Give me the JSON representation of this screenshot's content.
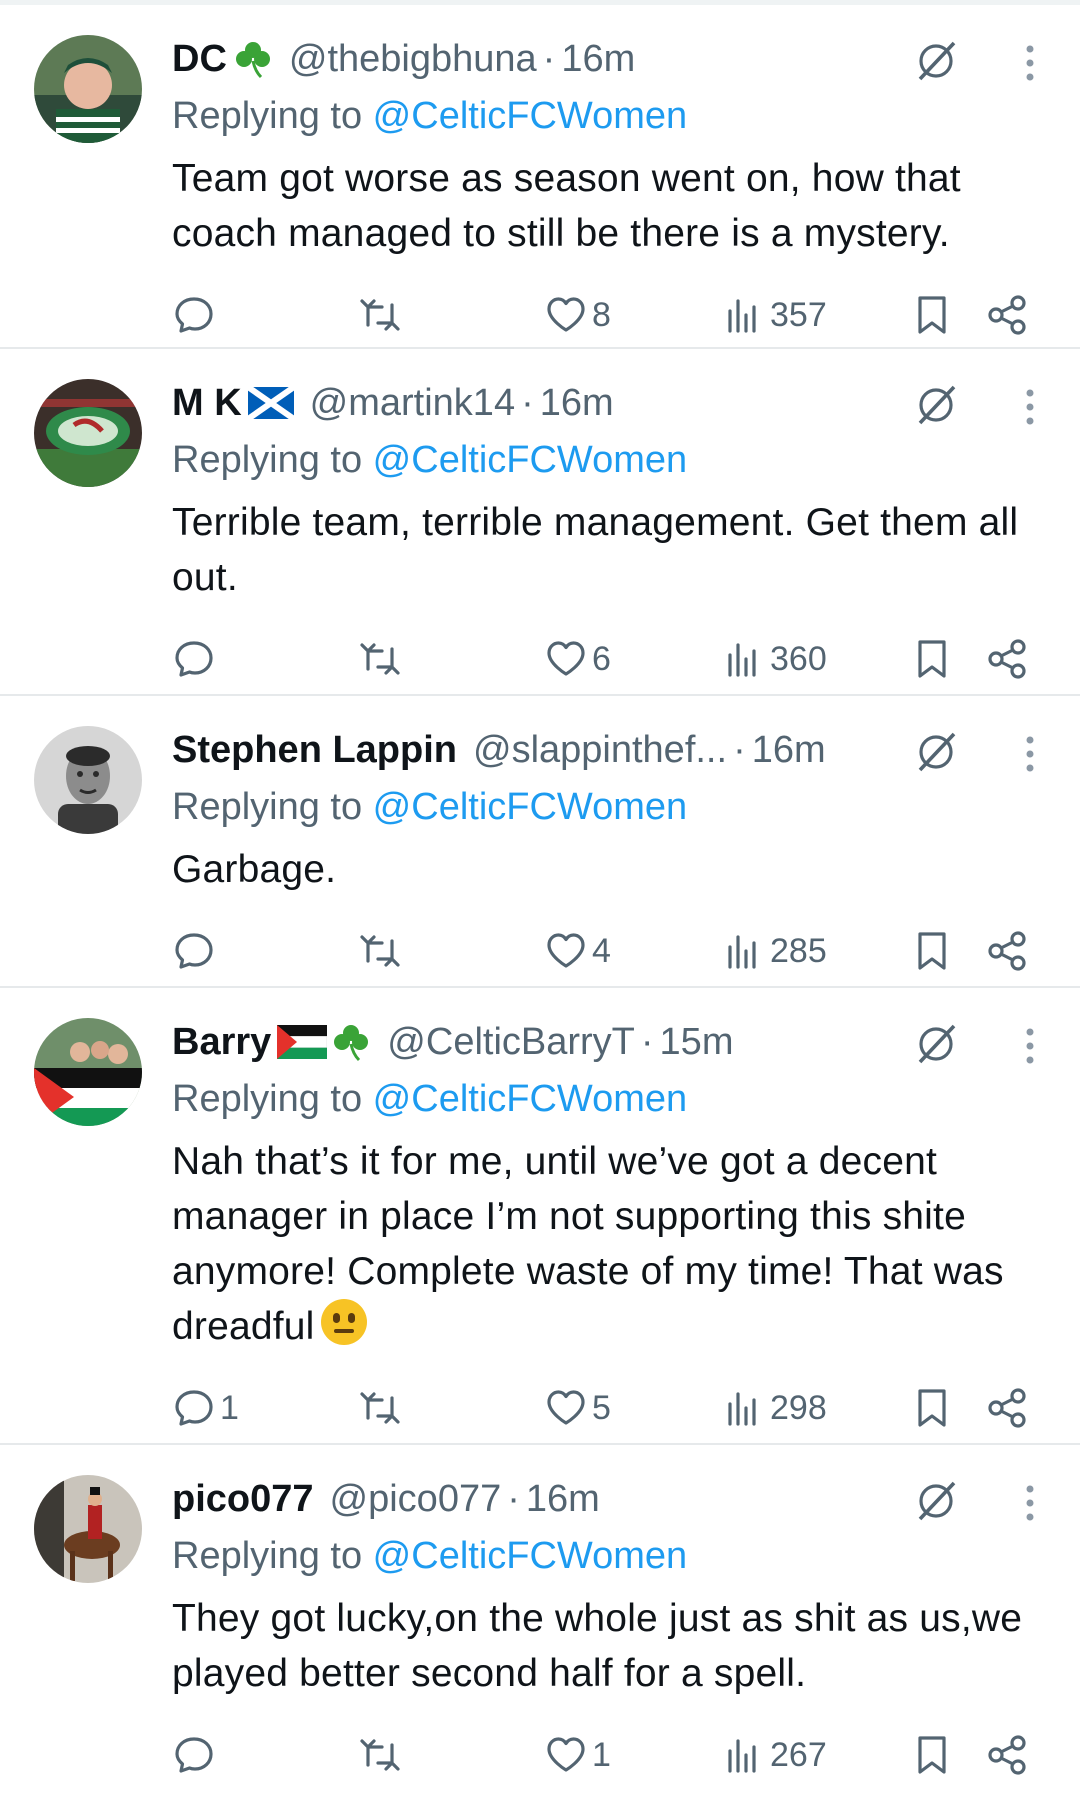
{
  "tweets": [
    {
      "name": "DC",
      "handle": "@thebigbhuna",
      "sep": "·",
      "time": "16m",
      "replying_prefix": "Replying to ",
      "replying_to": "@CelticFCWomen",
      "text": "Team got worse as season went on, how that coach managed to still be there is a mystery.",
      "replies": "",
      "likes": "8",
      "views": "357",
      "badges": [
        "shamrock-icon"
      ]
    },
    {
      "name": "M K",
      "handle": "@martink14",
      "sep": "·",
      "time": "16m",
      "replying_prefix": "Replying to ",
      "replying_to": "@CelticFCWomen",
      "text": "Terrible team, terrible management. Get them all out.",
      "replies": "",
      "likes": "6",
      "views": "360",
      "badges": [
        "scotland-flag-icon"
      ]
    },
    {
      "name": "Stephen Lappin",
      "handle": "@slappinthef...",
      "sep": "·",
      "time": "16m",
      "replying_prefix": "Replying to ",
      "replying_to": "@CelticFCWomen",
      "text": "Garbage.",
      "replies": "",
      "likes": "4",
      "views": "285",
      "badges": []
    },
    {
      "name": "Barry",
      "handle": "@CelticBarryT",
      "sep": "·",
      "time": "15m",
      "replying_prefix": "Replying to ",
      "replying_to": "@CelticFCWomen",
      "text": "Nah that’s it for me, until we’ve got a decent manager in place I’m not supporting this shite anymore! Complete waste of my time! That was dreadful",
      "replies": "1",
      "likes": "5",
      "views": "298",
      "badges": [
        "palestine-flag-icon",
        "shamrock-icon"
      ]
    },
    {
      "name": "pico077",
      "handle": "@pico077",
      "sep": "·",
      "time": "16m",
      "replying_prefix": "Replying to ",
      "replying_to": "@CelticFCWomen",
      "text": "They got lucky,on the whole just as shit as us,we played better second half for a spell.",
      "replies": "",
      "likes": "1",
      "views": "267",
      "badges": []
    }
  ],
  "colors": {
    "text": "#0f1419",
    "muted": "#536471",
    "link": "#1d9bf0",
    "divider": "#e6e9eb"
  }
}
